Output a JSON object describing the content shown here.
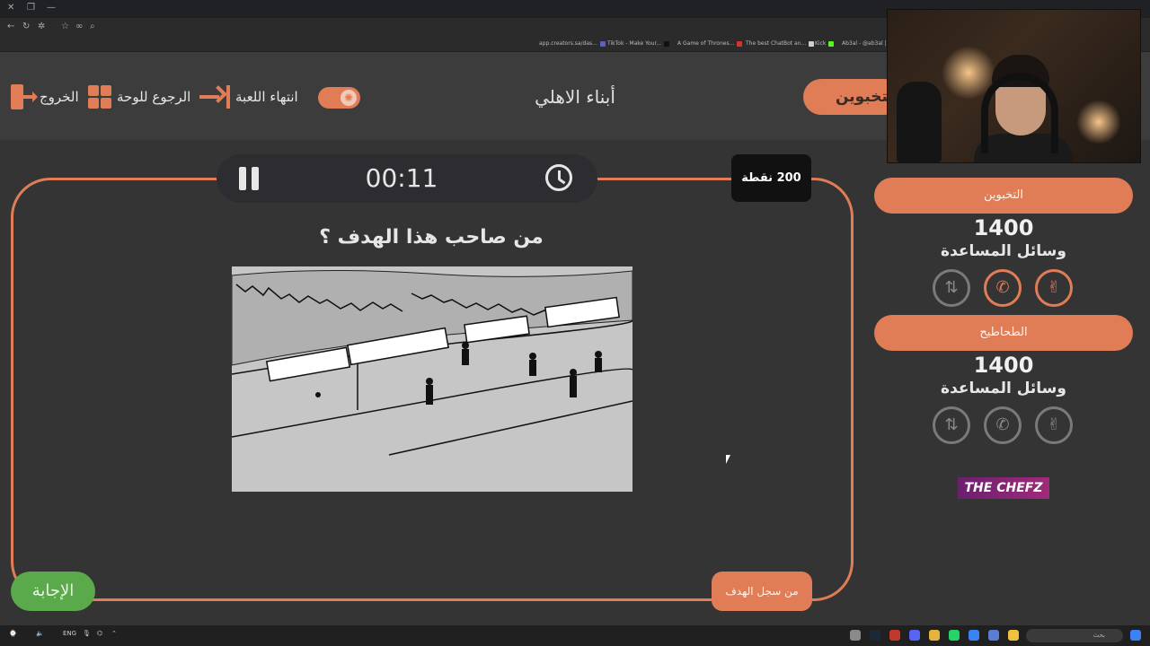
{
  "browser": {
    "bookmarks": [
      {
        "label": "app.creators.sa/das...",
        "color": "#5b5fc7"
      },
      {
        "label": "TikTok - Make Your...",
        "color": "#111111"
      },
      {
        "label": "A Game of Thrones...",
        "color": "#d9342b"
      },
      {
        "label": "The best ChatBot an...",
        "color": "#cfcfcf"
      },
      {
        "label": "Kick",
        "color": "#53fc18"
      },
      {
        "label": "Ab3al - @ab3al | ...",
        "color": "#5865f2"
      }
    ]
  },
  "header": {
    "exit_label": "الخروج",
    "board_label": "الرجوع للوحة",
    "end_label": "انتهاء اللعبة",
    "game_title": "أبناء الاهلي",
    "team_tab_label": "التخبوين"
  },
  "game": {
    "timer": "00:11",
    "points": "200 نقطة",
    "question": "من صاحب هذا الهدف ؟",
    "answer_button": "الإجابة",
    "hint_button": "من سجل الهدف"
  },
  "teams": [
    {
      "name": "التخبوين",
      "score": "1400",
      "aids_label": "وسائل المساعدة",
      "aids_active": true
    },
    {
      "name": "الطحاطيح",
      "score": "1400",
      "aids_label": "وسائل المساعدة",
      "aids_active": false
    }
  ],
  "sponsor": {
    "label": "THE CHEFZ"
  },
  "taskbar": {
    "lang": "ENG",
    "search_placeholder": "بحث"
  },
  "colors": {
    "accent": "#e07d57",
    "answer_green": "#5aa94a",
    "background": "#343434"
  }
}
